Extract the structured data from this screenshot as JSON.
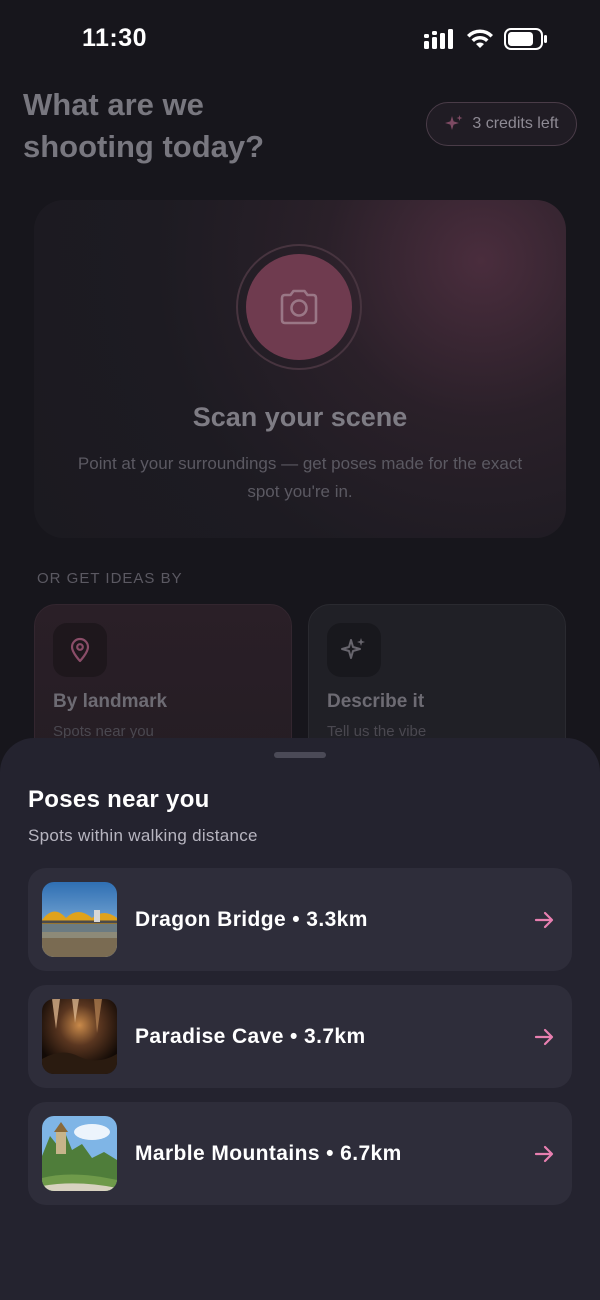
{
  "status_bar": {
    "time": "11:30",
    "icons": [
      "signal-icon",
      "wifi-icon",
      "battery-icon"
    ]
  },
  "header": {
    "title": "What are we shooting today?",
    "credits_label": "3 credits left",
    "credits_icon": "sparkle-icon"
  },
  "scan_card": {
    "icon": "camera-icon",
    "title": "Scan your scene",
    "description": "Point at your surroundings — get poses made for the exact spot you're in."
  },
  "ideas": {
    "section_label": "OR GET IDEAS BY",
    "cards": [
      {
        "icon": "map-pin-icon",
        "title": "By landmark",
        "subtitle": "Spots near you"
      },
      {
        "icon": "sparkle-icon",
        "title": "Describe it",
        "subtitle": "Tell us the vibe"
      }
    ]
  },
  "sheet": {
    "title": "Poses near you",
    "subtitle": "Spots within walking distance",
    "places": [
      {
        "name": "Dragon Bridge",
        "distance": "3.3km",
        "label": "Dragon Bridge • 3.3km",
        "thumb": "dragon-bridge-photo"
      },
      {
        "name": "Paradise Cave",
        "distance": "3.7km",
        "label": "Paradise Cave • 3.7km",
        "thumb": "paradise-cave-photo"
      },
      {
        "name": "Marble Mountains",
        "distance": "6.7km",
        "label": "Marble Mountains • 6.7km",
        "thumb": "marble-mountains-photo"
      }
    ],
    "arrow_icon": "arrow-right-icon"
  },
  "colors": {
    "accent_pink": "#e87fb0",
    "sheet_bg": "#24232f",
    "app_bg": "#17161c",
    "scan_button": "#6f3b4f"
  }
}
